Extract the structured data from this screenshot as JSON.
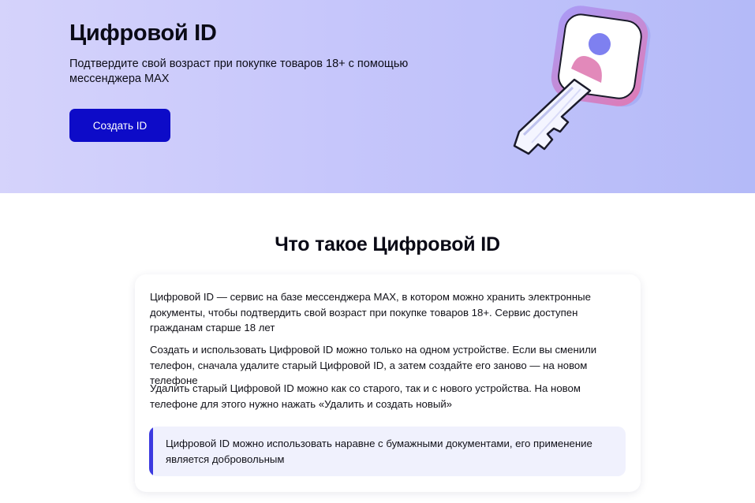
{
  "hero": {
    "title": "Цифровой ID",
    "subtitle": "Подтвердите свой возраст при покупке товаров 18+ с помощью мессенджера MAX",
    "create_button": "Создать ID",
    "illustration": "digital-id-key"
  },
  "about": {
    "title": "Что такое Цифровой ID",
    "paragraphs": [
      "Цифровой ID — сервис на базе мессенджера MAX, в котором можно хранить электронные документы, чтобы подтвердить свой возраст при покупке товаров 18+. Сервис доступен гражданам старше 18 лет",
      "Создать и использовать Цифровой ID можно только на одном устройстве. Если вы сменили телефон, сначала удалите старый Цифровой ID, а затем создайте его заново — на новом телефоне",
      "Удалить старый Цифровой ID можно как со старого, так и с нового устройства. На новом телефоне для этого нужно нажать «Удалить и создать новый»"
    ],
    "note": "Цифровой ID можно использовать наравне с бумажными документами, его применение является добровольным"
  },
  "colors": {
    "accent": "#0d0bc8",
    "note_bar": "#3c3ae0",
    "note_bg": "#f0f1fd"
  }
}
